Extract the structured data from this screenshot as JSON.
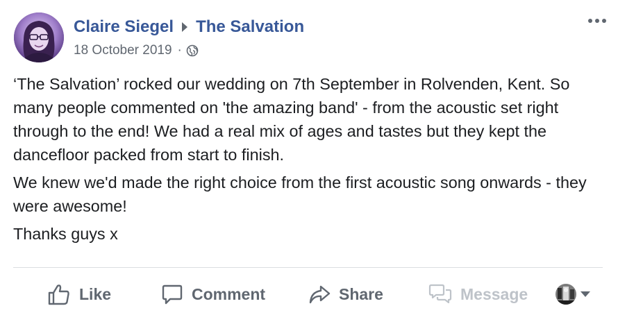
{
  "post": {
    "author": "Claire Siegel",
    "target_page": "The Salvation",
    "date": "18 October 2019",
    "separator": "·",
    "privacy_icon": "globe-icon",
    "more_icon": "ellipsis-icon",
    "paragraphs": [
      "‘The Salvation’ rocked our wedding on 7th September in Rolvenden, Kent. So many people commented on 'the amazing band' - from the acoustic set right through to the end! We had a real mix of ages and tastes but they kept the dancefloor packed from start to finish.",
      "We knew we'd made the right choice from the first acoustic song onwards - they were awesome!",
      "Thanks guys x"
    ]
  },
  "actions": {
    "like": {
      "label": "Like",
      "icon": "thumbs-up-icon"
    },
    "comment": {
      "label": "Comment",
      "icon": "comment-bubble-icon"
    },
    "share": {
      "label": "Share",
      "icon": "share-arrow-icon"
    },
    "message": {
      "label": "Message",
      "icon": "messages-icon",
      "disabled": true
    },
    "page_switcher": {
      "icon": "page-avatar-icon",
      "caret_icon": "caret-down-icon"
    }
  },
  "colors": {
    "link": "#385898",
    "secondary_text": "#606770",
    "body_text": "#1c1e21",
    "disabled": "#bec3c9",
    "divider": "#dadde1"
  }
}
